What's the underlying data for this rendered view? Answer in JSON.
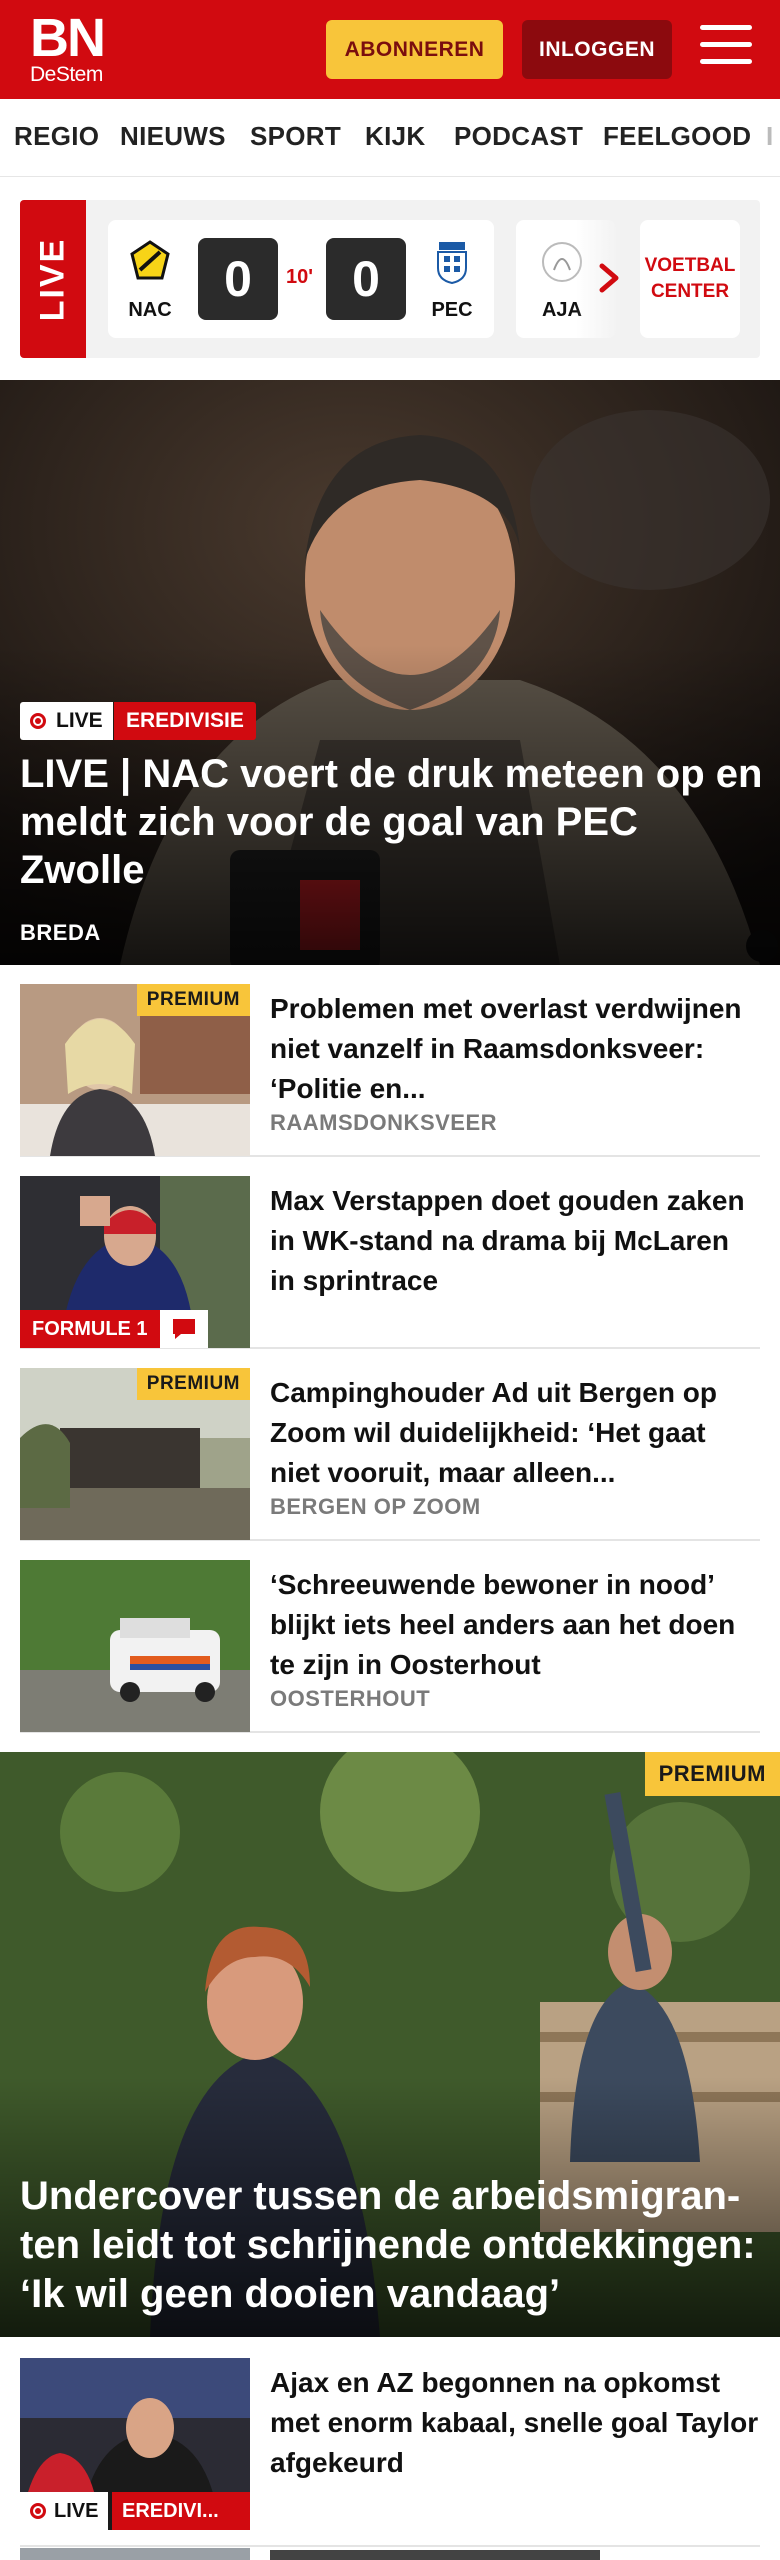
{
  "header": {
    "logo_main": "BN",
    "logo_sub": "DeStem",
    "subscribe_label": "ABONNEREN",
    "login_label": "INLOGGEN"
  },
  "nav": {
    "items": [
      "REGIO",
      "NIEUWS",
      "SPORT",
      "KIJK",
      "PODCAST",
      "FEELGOOD",
      "I"
    ]
  },
  "live_widget": {
    "tag": "LIVE",
    "match": {
      "home_code": "NAC",
      "home_score": "0",
      "minute": "10'",
      "away_score": "0",
      "away_code": "PEC"
    },
    "next_match_code": "AJA",
    "center_line1": "VOETBAL",
    "center_line2": "CENTER"
  },
  "hero": {
    "live_label": "LIVE",
    "category": "EREDIVISIE",
    "title": "LIVE | NAC voert de druk meteen op en meldt zich voor de goal van PEC Zwolle",
    "location": "BREDA"
  },
  "articles": [
    {
      "badge": "PREMIUM",
      "title": "Problemen met overlast verdwijnen niet vanzelf in Raamsdonksveer: ‘Politie en...",
      "location": "RAAMSDONKSVEER"
    },
    {
      "category": "FORMULE 1",
      "title": "Max Verstappen doet gouden zaken in WK-stand na drama bij McLaren in sprintrace"
    },
    {
      "badge": "PREMIUM",
      "title": "Campinghouder Ad uit Bergen op Zoom wil duidelijkheid: ‘Het gaat niet vooruit, maar alleen...",
      "location": "BERGEN OP ZOOM"
    },
    {
      "title": "‘Schreeuwende bewoner in nood’ blijkt iets heel anders aan het doen te zijn in Oosterhout",
      "location": "OOSTERHOUT"
    }
  ],
  "feature": {
    "badge": "PREMIUM",
    "title": "Undercover tussen de arbeidsmigran­ten leidt tot schrijnende ontdekkin­gen: ‘Ik wil geen dooien vandaag’"
  },
  "article_5": {
    "live_label": "LIVE",
    "category": "EREDIVI...",
    "title": "Ajax en AZ begonnen na opkomst met enorm kabaal, snelle goal Taylor afgekeurd"
  },
  "colors": {
    "brand_red": "#d10a10",
    "premium_yellow": "#f8c53a",
    "login_dark_red": "#8c0a0e"
  }
}
